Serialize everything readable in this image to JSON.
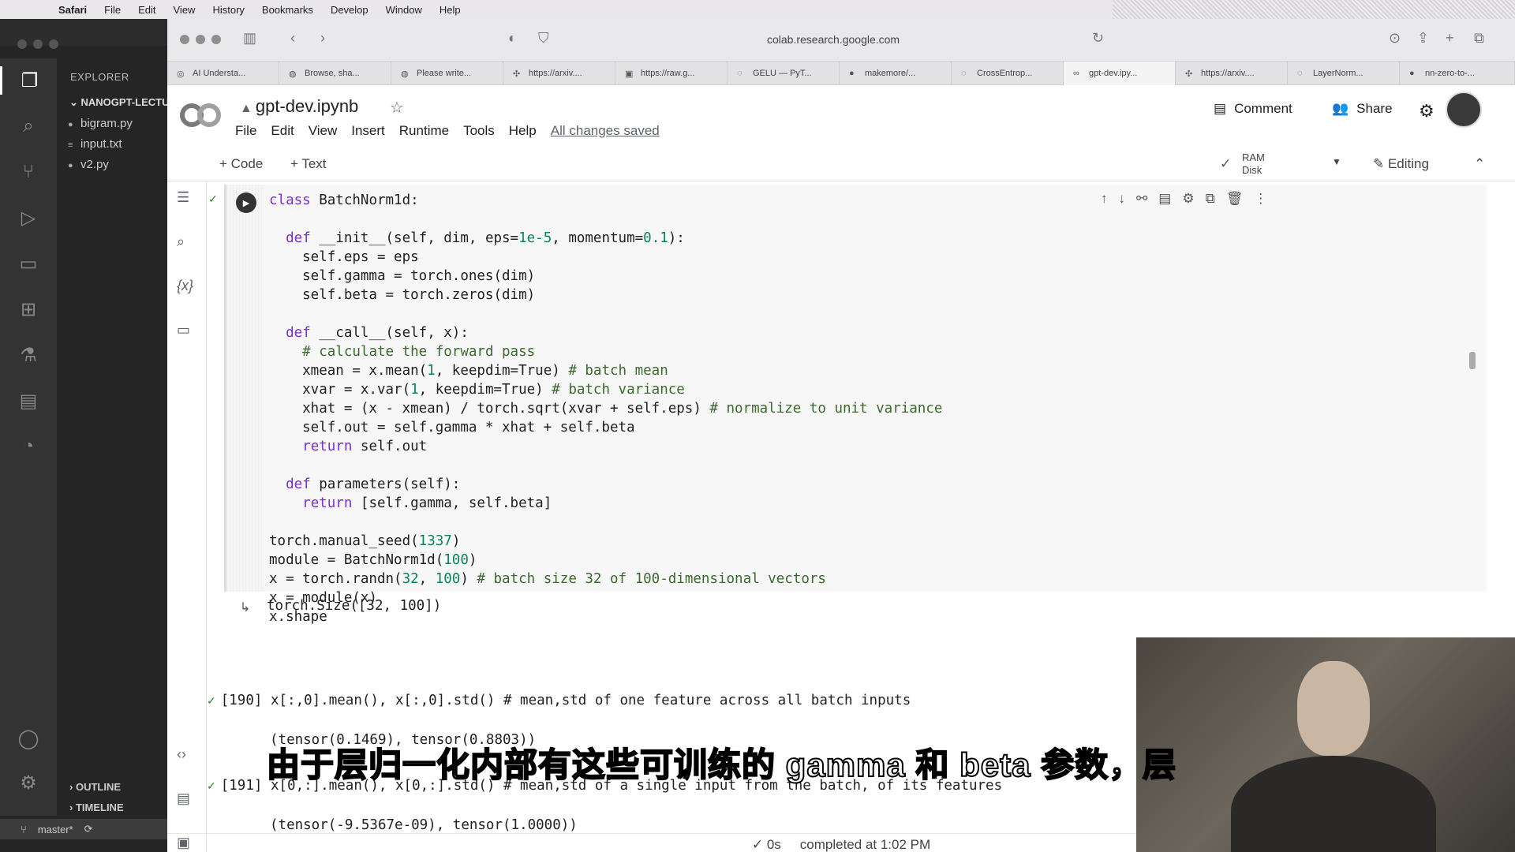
{
  "menubar": {
    "app": "Safari",
    "items": [
      "File",
      "Edit",
      "View",
      "History",
      "Bookmarks",
      "Develop",
      "Window",
      "Help"
    ]
  },
  "vscode": {
    "explorer_header": "EXPLORER",
    "folder": "NANOGPT-LECTU",
    "files": [
      "bigram.py",
      "input.txt",
      "v2.py"
    ],
    "outline": "OUTLINE",
    "timeline": "TIMELINE",
    "branch": "master*"
  },
  "safari": {
    "url": "colab.research.google.com",
    "tabs": [
      "AI Understa...",
      "Browse, sha...",
      "Please write...",
      "https://arxiv....",
      "https://raw.g...",
      "GELU — PyT...",
      "makemore/...",
      "CrossEntrop...",
      "gpt-dev.ipy...",
      "https://arxiv....",
      "LayerNorm...",
      "nn-zero-to-..."
    ]
  },
  "colab": {
    "notebook_name": "gpt-dev.ipynb",
    "menus": [
      "File",
      "Edit",
      "View",
      "Insert",
      "Runtime",
      "Tools",
      "Help"
    ],
    "saved_status": "All changes saved",
    "comment": "Comment",
    "share": "Share",
    "add_code": "+ Code",
    "add_text": "+ Text",
    "ram": "RAM",
    "disk": "Disk",
    "editing": "Editing",
    "output1": "torch.Size([32, 100])",
    "cell190_prompt": "[190]",
    "cell190_code": "x[:,0].mean(), x[:,0].std() # mean,std of one feature across all batch inputs",
    "cell190_output": "(tensor(0.1469), tensor(0.8803))",
    "cell191_prompt": "[191]",
    "cell191_code": "x[0,:].mean(), x[0,:].std() # mean,std of a single input from the batch, of its features",
    "cell191_output": "(tensor(-9.5367e-09), tensor(1.0000))",
    "exec_time": "0s",
    "completed": "completed at 1:02 PM"
  },
  "subtitle": "由于层归一化内部有这些可训练的 gamma 和 beta 参数，层",
  "code_lines": [
    "class BatchNorm1d:",
    "",
    "  def __init__(self, dim, eps=1e-5, momentum=0.1):",
    "    self.eps = eps",
    "    self.gamma = torch.ones(dim)",
    "    self.beta = torch.zeros(dim)",
    "",
    "  def __call__(self, x):",
    "    # calculate the forward pass",
    "    xmean = x.mean(1, keepdim=True) # batch mean",
    "    xvar = x.var(1, keepdim=True) # batch variance",
    "    xhat = (x - xmean) / torch.sqrt(xvar + self.eps) # normalize to unit variance",
    "    self.out = self.gamma * xhat + self.beta",
    "    return self.out",
    "",
    "  def parameters(self):",
    "    return [self.gamma, self.beta]",
    "",
    "torch.manual_seed(1337)",
    "module = BatchNorm1d(100)",
    "x = torch.randn(32, 100) # batch size 32 of 100-dimensional vectors",
    "x = module(x)",
    "x.shape"
  ]
}
